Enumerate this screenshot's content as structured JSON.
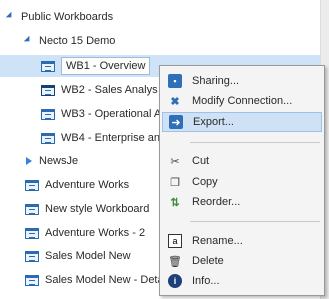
{
  "tree": {
    "root": "Public Workboards",
    "folder": "Necto 15 Demo",
    "children": [
      "WB1 - Overview",
      "WB2 - Sales Analys",
      "WB3 - Operational A",
      "WB4 - Enterprise an"
    ],
    "folder2": "NewsJe",
    "items": [
      "Adventure Works",
      "New style  Workboard",
      "Adventure Works - 2",
      "Sales Model New",
      "Sales Model New - Deta"
    ]
  },
  "menu": {
    "items": [
      "Sharing...",
      "Modify Connection...",
      "Export...",
      "Cut",
      "Copy",
      "Reorder...",
      "Rename...",
      "Delete",
      "Info..."
    ],
    "hovered": "Export..."
  }
}
